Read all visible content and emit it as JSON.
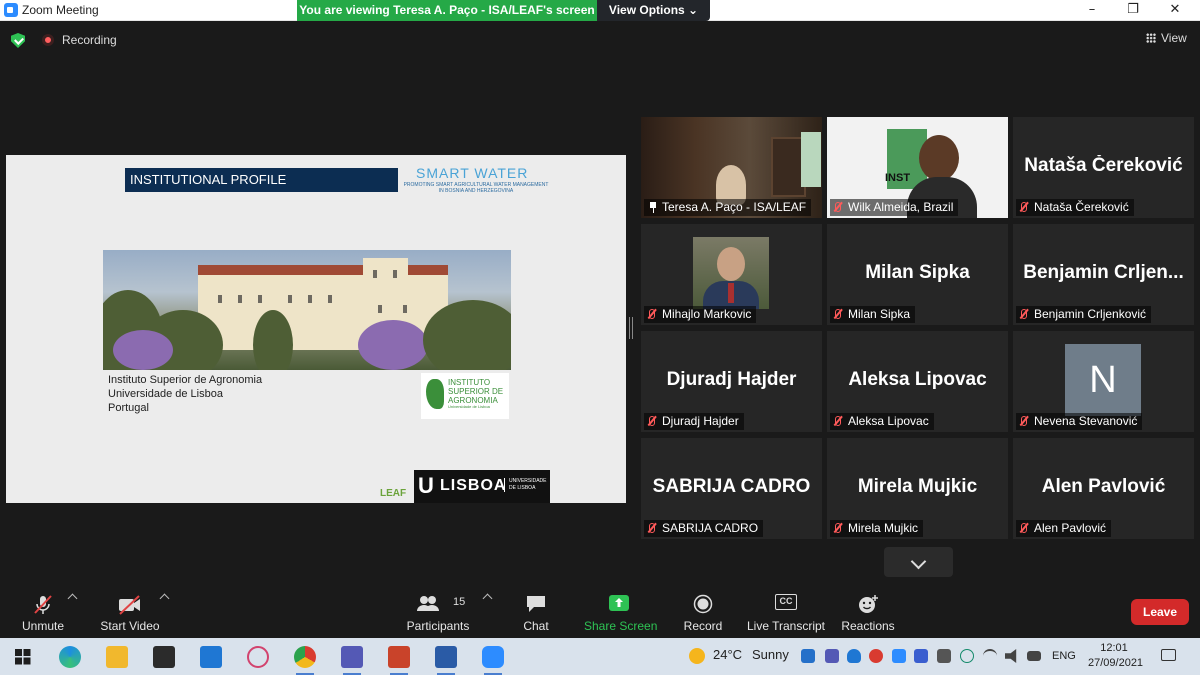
{
  "window": {
    "title": "Zoom Meeting",
    "controls": [
      "–",
      "❐",
      "✕"
    ]
  },
  "banner": {
    "sharing_text": "You are viewing Teresa A. Paço - ISA/LEAF's screen",
    "view_options": "View Options ⌄"
  },
  "status": {
    "recording": "Recording",
    "view": "View"
  },
  "slide": {
    "header": "INSTITUTIONAL PROFILE",
    "logo": "SMART WATER",
    "logo_sub": "PROMOTING SMART AGRICULTURAL WATER MANAGEMENT IN BOSNIA AND HERZEGOVINA",
    "address_line1": "Instituto Superior de Agronomia",
    "address_line2": "Universidade de Lisboa",
    "address_line3": "Portugal",
    "isa_logo_text": "INSTITUTO SUPERIOR DE AGRONOMIA",
    "isa_logo_sub": "Universidade de Lisboa",
    "leaf_logo": "LEAF",
    "lisboa_u": "U",
    "lisboa_text": "LISBOA",
    "lisboa_sub": "UNIVERSIDADE DE LISBOA"
  },
  "participants_gallery": [
    {
      "name": "Teresa A. Paço - ISA/LEAF",
      "big": "",
      "video": true,
      "pinned": true,
      "active": true
    },
    {
      "name": "Wilk Almeida, Brazil",
      "big": "",
      "video": true,
      "muted": true
    },
    {
      "name": "Nataša Čereković",
      "big": "Nataša Čereković",
      "muted": true
    },
    {
      "name": "Mihajlo Markovic",
      "big": "",
      "photo": true,
      "muted": true
    },
    {
      "name": "Milan Sipka",
      "big": "Milan Sipka",
      "muted": true
    },
    {
      "name": "Benjamin Crljenković",
      "big": "Benjamin  Crljen...",
      "muted": true
    },
    {
      "name": "Djuradj Hajder",
      "big": "Djuradj Hajder",
      "muted": true
    },
    {
      "name": "Aleksa Lipovac",
      "big": "Aleksa Lipovac",
      "muted": true
    },
    {
      "name": "Nevena Stevanović",
      "big": "",
      "avatar": "N",
      "muted": true
    },
    {
      "name": "SABRIJA CADRO",
      "big": "SABRIJA CADRO",
      "muted": true
    },
    {
      "name": "Mirela Mujkic",
      "big": "Mirela Mujkic",
      "muted": true
    },
    {
      "name": "Alen Pavlović",
      "big": "Alen Pavlović",
      "muted": true
    }
  ],
  "toolbar": {
    "unmute": "Unmute",
    "start_video": "Start Video",
    "participants": "Participants",
    "participants_count": "15",
    "chat": "Chat",
    "share_screen": "Share Screen",
    "record": "Record",
    "live_transcript": "Live Transcript",
    "cc": "CC",
    "reactions": "Reactions",
    "leave": "Leave",
    "share_color": "#2ec254"
  },
  "taskbar": {
    "temperature": "24°C",
    "weather": "Sunny",
    "language": "ENG",
    "time": "12:01",
    "date": "27/09/2021"
  }
}
